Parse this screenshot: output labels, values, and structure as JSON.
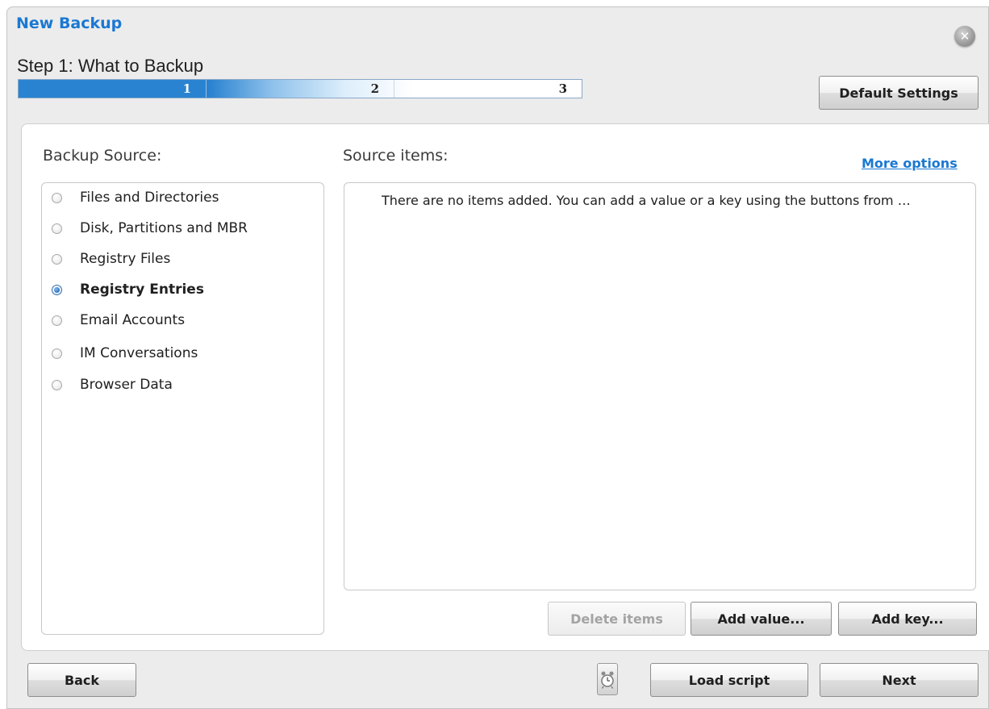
{
  "window": {
    "title": "New Backup",
    "step_title": "Step 1: What to Backup",
    "close_glyph": "✕"
  },
  "progress": {
    "steps": [
      "1",
      "2",
      "3"
    ],
    "current_step": 1
  },
  "header": {
    "default_settings_label": "Default Settings"
  },
  "backup_source": {
    "label": "Backup Source:",
    "options": [
      {
        "label": "Files and Directories",
        "selected": false
      },
      {
        "label": "Disk, Partitions and MBR",
        "selected": false
      },
      {
        "label": "Registry Files",
        "selected": false
      },
      {
        "label": "Registry Entries",
        "selected": true
      },
      {
        "label": "Email Accounts",
        "selected": false
      },
      {
        "label": "IM Conversations",
        "selected": false
      },
      {
        "label": "Browser Data",
        "selected": false
      }
    ]
  },
  "source_items": {
    "label": "Source items:",
    "more_options_label": "More options",
    "empty_message": "There are no items added. You can add a value or a key using the buttons from …",
    "buttons": {
      "delete": "Delete items",
      "add_value": "Add value...",
      "add_key": "Add key..."
    }
  },
  "footer": {
    "back_label": "Back",
    "schedule_icon": "alarm-clock-icon",
    "load_script_label": "Load script",
    "next_label": "Next"
  },
  "colors": {
    "accent": "#1a78d2",
    "progress_fill": "#2a83d1",
    "window_bg": "#ececec"
  }
}
